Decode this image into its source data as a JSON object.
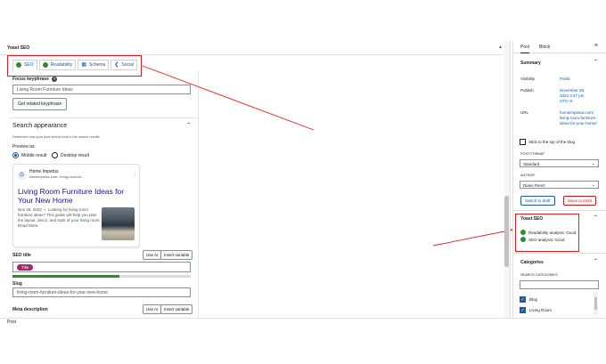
{
  "panel": {
    "title": "Yoast SEO",
    "caret": "▲"
  },
  "tabs": [
    {
      "label": "SEO",
      "icon": "green-dot"
    },
    {
      "label": "Readability",
      "icon": "green-dot"
    },
    {
      "label": "Schema",
      "icon": "grid-icon"
    },
    {
      "label": "Social",
      "icon": "share-icon"
    }
  ],
  "focus": {
    "label": "Focus keyphrase",
    "help": "?",
    "value": "Living Room Furniture Ideas",
    "related_button": "Get related keyphrase"
  },
  "search_appearance": {
    "title": "Search appearance",
    "description": "Determine how your post should look in the search results.",
    "preview_label": "Preview as:",
    "mobile": "Mobile result",
    "desktop": "Desktop result",
    "site_name": "Home Impetus",
    "site_url": "homeimpetus.com › living-room-fur...",
    "serp_title": "Living Room Furniture Ideas for Your New Home",
    "serp_desc": "Nov 28, 2022 ・ Looking for living room furniture ideas? This guide will help you plan the layout, decor, and style of your living room. Read More.",
    "more": "⋮"
  },
  "seo_title": {
    "label": "SEO title",
    "use_ai": "Use AI",
    "insert_variable": "Insert variable",
    "pill": "Title",
    "progress": 0.6
  },
  "slug": {
    "label": "Slug",
    "value": "living-room-furniture-ideas-for-your-new-home"
  },
  "meta": {
    "label": "Meta description",
    "use_ai": "Use AI",
    "insert_variable": "Insert variable"
  },
  "sidebar": {
    "tabs": [
      "Post",
      "Block"
    ],
    "close": "×",
    "summary": "Summary",
    "visibility_label": "Visibility",
    "visibility_value": "Public",
    "publish_label": "Publish",
    "publish_value": "November 28, 2022 3:47 pm UTC+0",
    "url_label": "URL",
    "url_value": "homeimpetus.com/ living-room-furniture-ideas-for-your-home/",
    "sticky": "Stick to the top of the blog",
    "post_format_label": "POST FORMAT",
    "post_format_value": "Standard",
    "author_label": "AUTHOR",
    "author_value": "Diane Perez",
    "switch_draft": "Switch to draft",
    "move_trash": "Move to trash",
    "yoast_title": "Yoast SEO",
    "readability": "Readability analysis: Good",
    "seo_analysis": "SEO analysis: Good",
    "categories": "Categories",
    "search_categories": "SEARCH CATEGORIES",
    "cat1": "Blog",
    "cat2": "Living Room"
  },
  "footer": "Post",
  "colors": {
    "accent": "#1a5aa6",
    "good": "#2e8b2e",
    "annotation": "#e02020",
    "pill": "#a4286a"
  }
}
